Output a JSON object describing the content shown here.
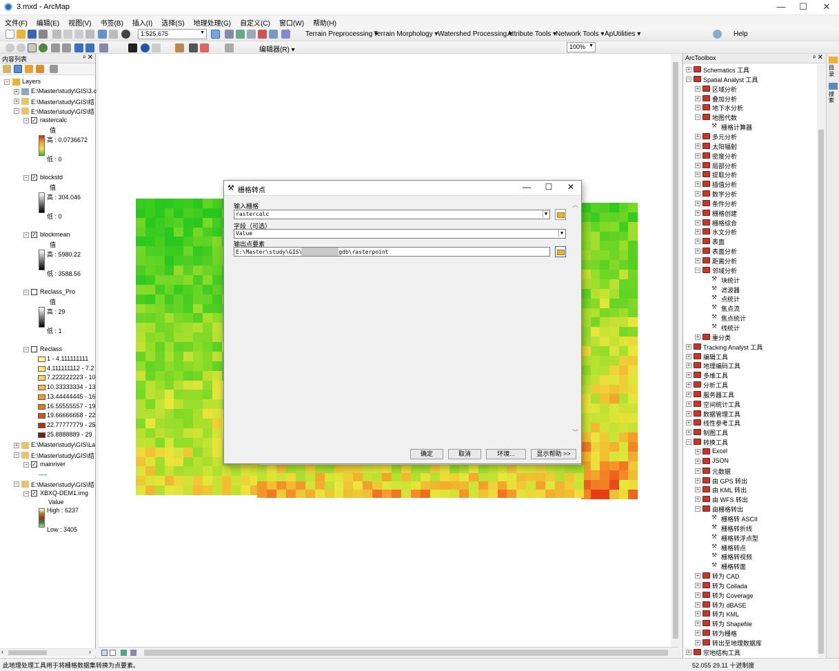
{
  "window": {
    "title": "3.mxd - ArcMap"
  },
  "menu": [
    "文件(F)",
    "编辑(E)",
    "视图(V)",
    "书签(B)",
    "插入(I)",
    "选择(S)",
    "地理处理(G)",
    "自定义(C)",
    "窗口(W)",
    "帮助(H)"
  ],
  "toolbar": {
    "scale": "1:525,675",
    "extensions": [
      "Terrain Preprocessing ▾",
      "Terrain Morphology ▾",
      "Watershed Processing ▾",
      "Attribute Tools ▾",
      "Network Tools ▾",
      "ApUtilities ▾"
    ],
    "help": "Help",
    "editor": "编辑器(R) ▾",
    "zoom": "100%"
  },
  "toc": {
    "title": "内容列表",
    "root": "Layers",
    "sources": [
      "E:\\Master\\study\\GIS\\3.c",
      "E:\\Master\\study\\GIS\\结",
      "E:\\Master\\study\\GIS\\结",
      "E:\\Master\\study\\GIS\\La",
      "E:\\Master\\study\\GIS\\结",
      "E:\\Master\\study\\GIS\\结"
    ],
    "layers": {
      "rastercalc": {
        "name": "rastercalc",
        "field": "值",
        "high": "高 : 0.0736672",
        "low": "低 : 0"
      },
      "blockstd": {
        "name": "blockstd",
        "field": "值",
        "high": "高 : 304.046",
        "low": "低 : 0"
      },
      "blockmean": {
        "name": "blockmean",
        "field": "值",
        "high": "高 : 5980.22",
        "low": "低 : 3588.56"
      },
      "reclass_pro": {
        "name": "Reclass_Pro",
        "field": "值",
        "high": "高 : 29",
        "low": "低 : 1"
      },
      "reclass": {
        "name": "Reclass",
        "classes": [
          "1 - 4.111111111",
          "4.111111112 - 7.2",
          "7.222222223 - 10",
          "10.33333334 - 13",
          "13.44444445 - 16",
          "16.55555557 - 19",
          "19.66666668 - 22",
          "22.77777779 - 25",
          "25.8888889 - 29"
        ],
        "colors": [
          "#fff3a0",
          "#ffe47a",
          "#ffd45a",
          "#f9b84a",
          "#f29a30",
          "#e07a22",
          "#c85a18",
          "#a83a10",
          "#7a1e08"
        ]
      },
      "mainriver": {
        "name": "mainriver"
      },
      "dem": {
        "name": "XBXQ-DEM1.img",
        "field": "Value",
        "high": "High : 6237",
        "low": "Low : 3405"
      }
    }
  },
  "dialog": {
    "title": "栅格转点",
    "input_label": "输入栅格",
    "input_value": "rastercalc",
    "field_label": "字段（可选）",
    "field_value": "Value",
    "output_label": "输出点要素",
    "output_value": "E:\\Master\\study\\GIS\\结课          题\\3\\3.gdb\\rasterpoint",
    "ok": "确定",
    "cancel": "取消",
    "env": "环境...",
    "help": "显示帮助 >>"
  },
  "arctoolbox": {
    "title": "ArcToolbox",
    "items": [
      {
        "label": "Schematics 工具",
        "lvl": 0,
        "ex": "+",
        "kind": "box"
      },
      {
        "label": "Spatial Analyst 工具",
        "lvl": 0,
        "ex": "−",
        "kind": "box"
      },
      {
        "label": "区域分析",
        "lvl": 1,
        "ex": "+",
        "kind": "box"
      },
      {
        "label": "叠加分析",
        "lvl": 1,
        "ex": "+",
        "kind": "box"
      },
      {
        "label": "地下水分析",
        "lvl": 1,
        "ex": "+",
        "kind": "box"
      },
      {
        "label": "地图代数",
        "lvl": 1,
        "ex": "−",
        "kind": "box"
      },
      {
        "label": "栅格计算器",
        "lvl": 2,
        "ex": "",
        "kind": "tool"
      },
      {
        "label": "多元分析",
        "lvl": 1,
        "ex": "+",
        "kind": "box"
      },
      {
        "label": "太阳辐射",
        "lvl": 1,
        "ex": "+",
        "kind": "box"
      },
      {
        "label": "密度分析",
        "lvl": 1,
        "ex": "+",
        "kind": "box"
      },
      {
        "label": "局部分析",
        "lvl": 1,
        "ex": "+",
        "kind": "box"
      },
      {
        "label": "提取分析",
        "lvl": 1,
        "ex": "+",
        "kind": "box"
      },
      {
        "label": "插值分析",
        "lvl": 1,
        "ex": "+",
        "kind": "box"
      },
      {
        "label": "数学分析",
        "lvl": 1,
        "ex": "+",
        "kind": "box"
      },
      {
        "label": "条件分析",
        "lvl": 1,
        "ex": "+",
        "kind": "box"
      },
      {
        "label": "栅格创建",
        "lvl": 1,
        "ex": "+",
        "kind": "box"
      },
      {
        "label": "栅格综合",
        "lvl": 1,
        "ex": "+",
        "kind": "box"
      },
      {
        "label": "水文分析",
        "lvl": 1,
        "ex": "+",
        "kind": "box"
      },
      {
        "label": "表面",
        "lvl": 1,
        "ex": "+",
        "kind": "box"
      },
      {
        "label": "表面分析",
        "lvl": 1,
        "ex": "+",
        "kind": "box"
      },
      {
        "label": "距离分析",
        "lvl": 1,
        "ex": "+",
        "kind": "box"
      },
      {
        "label": "邻域分析",
        "lvl": 1,
        "ex": "−",
        "kind": "box"
      },
      {
        "label": "块统计",
        "lvl": 2,
        "ex": "",
        "kind": "tool"
      },
      {
        "label": "滤波器",
        "lvl": 2,
        "ex": "",
        "kind": "tool"
      },
      {
        "label": "点统计",
        "lvl": 2,
        "ex": "",
        "kind": "tool"
      },
      {
        "label": "焦点流",
        "lvl": 2,
        "ex": "",
        "kind": "tool"
      },
      {
        "label": "焦点统计",
        "lvl": 2,
        "ex": "",
        "kind": "tool"
      },
      {
        "label": "线统计",
        "lvl": 2,
        "ex": "",
        "kind": "tool"
      },
      {
        "label": "重分类",
        "lvl": 1,
        "ex": "+",
        "kind": "box"
      },
      {
        "label": "Tracking Analyst 工具",
        "lvl": 0,
        "ex": "+",
        "kind": "box"
      },
      {
        "label": "编辑工具",
        "lvl": 0,
        "ex": "+",
        "kind": "box"
      },
      {
        "label": "地理编码工具",
        "lvl": 0,
        "ex": "+",
        "kind": "box"
      },
      {
        "label": "多维工具",
        "lvl": 0,
        "ex": "+",
        "kind": "box"
      },
      {
        "label": "分析工具",
        "lvl": 0,
        "ex": "+",
        "kind": "box"
      },
      {
        "label": "服务器工具",
        "lvl": 0,
        "ex": "+",
        "kind": "box"
      },
      {
        "label": "空间统计工具",
        "lvl": 0,
        "ex": "+",
        "kind": "box"
      },
      {
        "label": "数据管理工具",
        "lvl": 0,
        "ex": "+",
        "kind": "box"
      },
      {
        "label": "线性参考工具",
        "lvl": 0,
        "ex": "+",
        "kind": "box"
      },
      {
        "label": "制图工具",
        "lvl": 0,
        "ex": "+",
        "kind": "box"
      },
      {
        "label": "转换工具",
        "lvl": 0,
        "ex": "−",
        "kind": "box"
      },
      {
        "label": "Excel",
        "lvl": 1,
        "ex": "+",
        "kind": "box"
      },
      {
        "label": "JSON",
        "lvl": 1,
        "ex": "+",
        "kind": "box"
      },
      {
        "label": "元数据",
        "lvl": 1,
        "ex": "+",
        "kind": "box"
      },
      {
        "label": "由 GPS 转出",
        "lvl": 1,
        "ex": "+",
        "kind": "box"
      },
      {
        "label": "由 KML 转出",
        "lvl": 1,
        "ex": "+",
        "kind": "box"
      },
      {
        "label": "由 WFS 转出",
        "lvl": 1,
        "ex": "+",
        "kind": "box"
      },
      {
        "label": "由栅格转出",
        "lvl": 1,
        "ex": "−",
        "kind": "box"
      },
      {
        "label": "栅格转 ASCII",
        "lvl": 2,
        "ex": "",
        "kind": "tool"
      },
      {
        "label": "栅格转折线",
        "lvl": 2,
        "ex": "",
        "kind": "tool"
      },
      {
        "label": "栅格转浮点型",
        "lvl": 2,
        "ex": "",
        "kind": "tool"
      },
      {
        "label": "栅格转点",
        "lvl": 2,
        "ex": "",
        "kind": "tool"
      },
      {
        "label": "栅格转视频",
        "lvl": 2,
        "ex": "",
        "kind": "tool"
      },
      {
        "label": "栅格转面",
        "lvl": 2,
        "ex": "",
        "kind": "tool"
      },
      {
        "label": "转为 CAD",
        "lvl": 1,
        "ex": "+",
        "kind": "box"
      },
      {
        "label": "转为 Collada",
        "lvl": 1,
        "ex": "+",
        "kind": "box"
      },
      {
        "label": "转为 Coverage",
        "lvl": 1,
        "ex": "+",
        "kind": "box"
      },
      {
        "label": "转为 dBASE",
        "lvl": 1,
        "ex": "+",
        "kind": "box"
      },
      {
        "label": "转为 KML",
        "lvl": 1,
        "ex": "+",
        "kind": "box"
      },
      {
        "label": "转为 Shapefile",
        "lvl": 1,
        "ex": "+",
        "kind": "box"
      },
      {
        "label": "转为栅格",
        "lvl": 1,
        "ex": "+",
        "kind": "box"
      },
      {
        "label": "转出至地理数据库",
        "lvl": 1,
        "ex": "+",
        "kind": "box"
      },
      {
        "label": "宗地结构工具",
        "lvl": 0,
        "ex": "+",
        "kind": "box"
      }
    ]
  },
  "side_tabs": [
    "目录",
    "搜索"
  ],
  "status": {
    "message": "此地理处理工具用于将栅格数据集转换为点要素。",
    "coords": "52.055  29.11 十进制度"
  }
}
